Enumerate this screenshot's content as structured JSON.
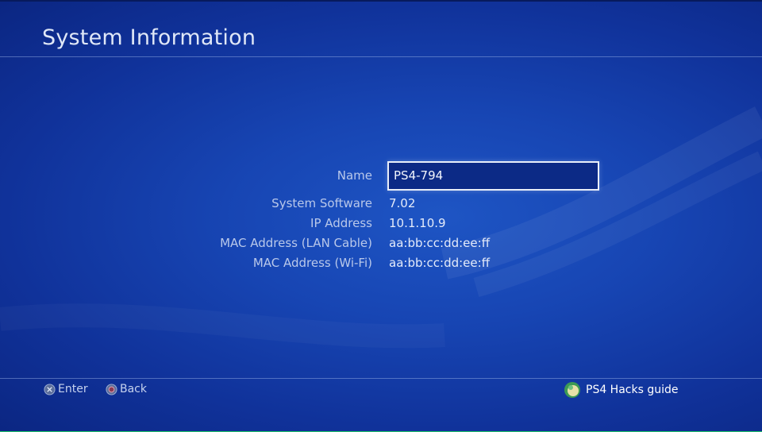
{
  "header": {
    "title": "System Information"
  },
  "info": {
    "name_label": "Name",
    "name_value": "PS4-794",
    "rows": [
      {
        "label": "System Software",
        "value": "7.02"
      },
      {
        "label": "IP Address",
        "value": "10.1.10.9"
      },
      {
        "label": "MAC Address (LAN Cable)",
        "value": "aa:bb:cc:dd:ee:ff"
      },
      {
        "label": "MAC Address (Wi-Fi)",
        "value": "aa:bb:cc:dd:ee:ff"
      }
    ]
  },
  "footer": {
    "enter_label": "Enter",
    "back_label": "Back",
    "enter_icon": "cross-button-icon",
    "back_icon": "circle-button-icon"
  },
  "brand": {
    "label": "PS4 Hacks guide",
    "icon": "brand-logo-icon"
  },
  "colors": {
    "background": "#1745b3",
    "accent_strip": "#1fc46a"
  }
}
